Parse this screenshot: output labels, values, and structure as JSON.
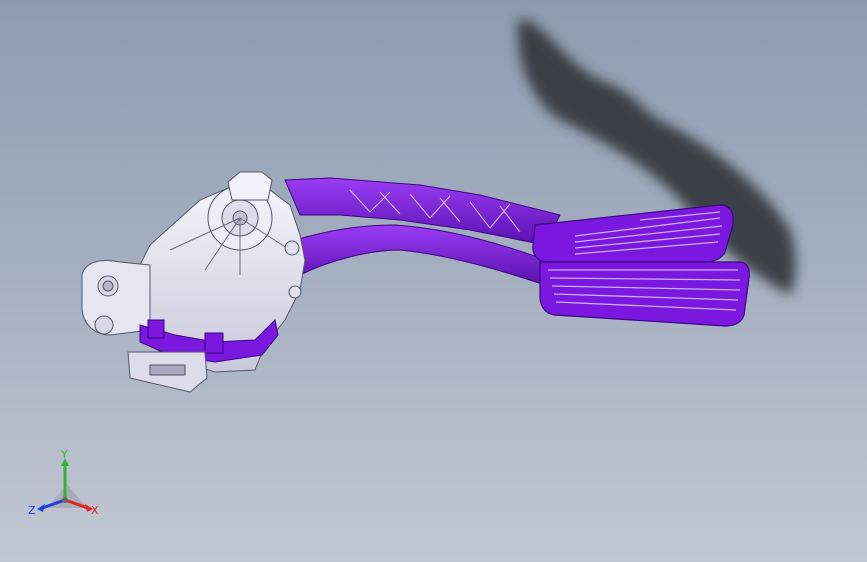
{
  "viewport": {
    "background_top": "#8f9cb0",
    "background_bottom": "#c2c8d3"
  },
  "model": {
    "part_color": "#7a18e0",
    "part_dark": "#4a0a9a",
    "housing_color": "#e8e8f4",
    "shadow_color": "#2a2d33"
  },
  "triad": {
    "x_label": "X",
    "y_label": "Y",
    "z_label": "Z",
    "x_color": "#e0261f",
    "y_color": "#2fb52f",
    "z_color": "#1f3fe0"
  }
}
